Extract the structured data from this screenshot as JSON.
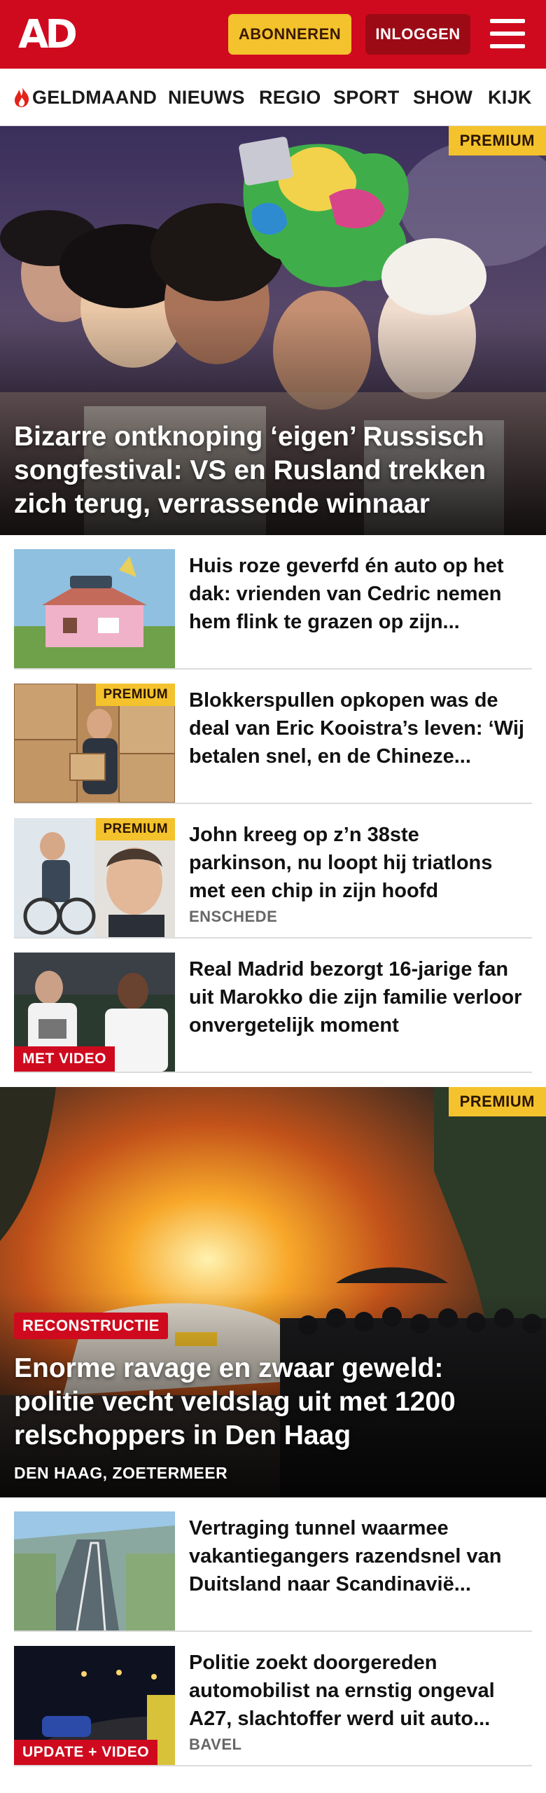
{
  "header": {
    "logo": "AD",
    "subscribe_label": "ABONNEREN",
    "login_label": "INLOGGEN",
    "brand_color": "#cf0a1e",
    "accent_color": "#f4c22c"
  },
  "nav": {
    "items": [
      {
        "label": "GELDMAAND",
        "icon": "flame-icon"
      },
      {
        "label": "NIEUWS"
      },
      {
        "label": "REGIO"
      },
      {
        "label": "SPORT"
      },
      {
        "label": "SHOW"
      },
      {
        "label": "KIJK"
      }
    ]
  },
  "hero1": {
    "badge": "PREMIUM",
    "title": "Bizarre ontknoping ‘eigen’ Russisch songfestival: VS en Rusland trekken zich terug, verrassende winnaar"
  },
  "articles_a": [
    {
      "title": "Huis roze geverfd én auto op het dak: vrienden van Cedric nemen hem flink te grazen op zijn...",
      "badge": "",
      "label": "",
      "location": ""
    },
    {
      "title": "Blokkerspullen opkopen was de deal van Eric Kooistra’s leven: ‘Wij betalen snel, en de Chineze...",
      "badge": "PREMIUM",
      "label": "",
      "location": ""
    },
    {
      "title": "John kreeg op z’n 38ste parkinson, nu loopt hij triatlons met een chip in zijn hoofd",
      "badge": "PREMIUM",
      "label": "",
      "location": "ENSCHEDE"
    },
    {
      "title": "Real Madrid bezorgt 16-jarige fan uit Marokko die zijn familie verloor onvergetelijk moment",
      "badge": "",
      "label": "MET VIDEO",
      "location": ""
    }
  ],
  "hero2": {
    "badge": "PREMIUM",
    "label": "RECONSTRUCTIE",
    "title": "Enorme ravage en zwaar geweld: politie vecht veldslag uit met 1200 relschoppers in Den Haag",
    "location": "DEN HAAG, ZOETERMEER"
  },
  "articles_b": [
    {
      "title": "Vertraging tunnel waarmee vakantiegangers razendsnel van Duitsland naar Scandinavië...",
      "badge": "",
      "label": "",
      "location": ""
    },
    {
      "title": "Politie zoekt doorgereden automobilist na ernstig ongeval A27, slachtoffer werd uit auto...",
      "badge": "",
      "label": "UPDATE + VIDEO",
      "location": "BAVEL"
    }
  ]
}
